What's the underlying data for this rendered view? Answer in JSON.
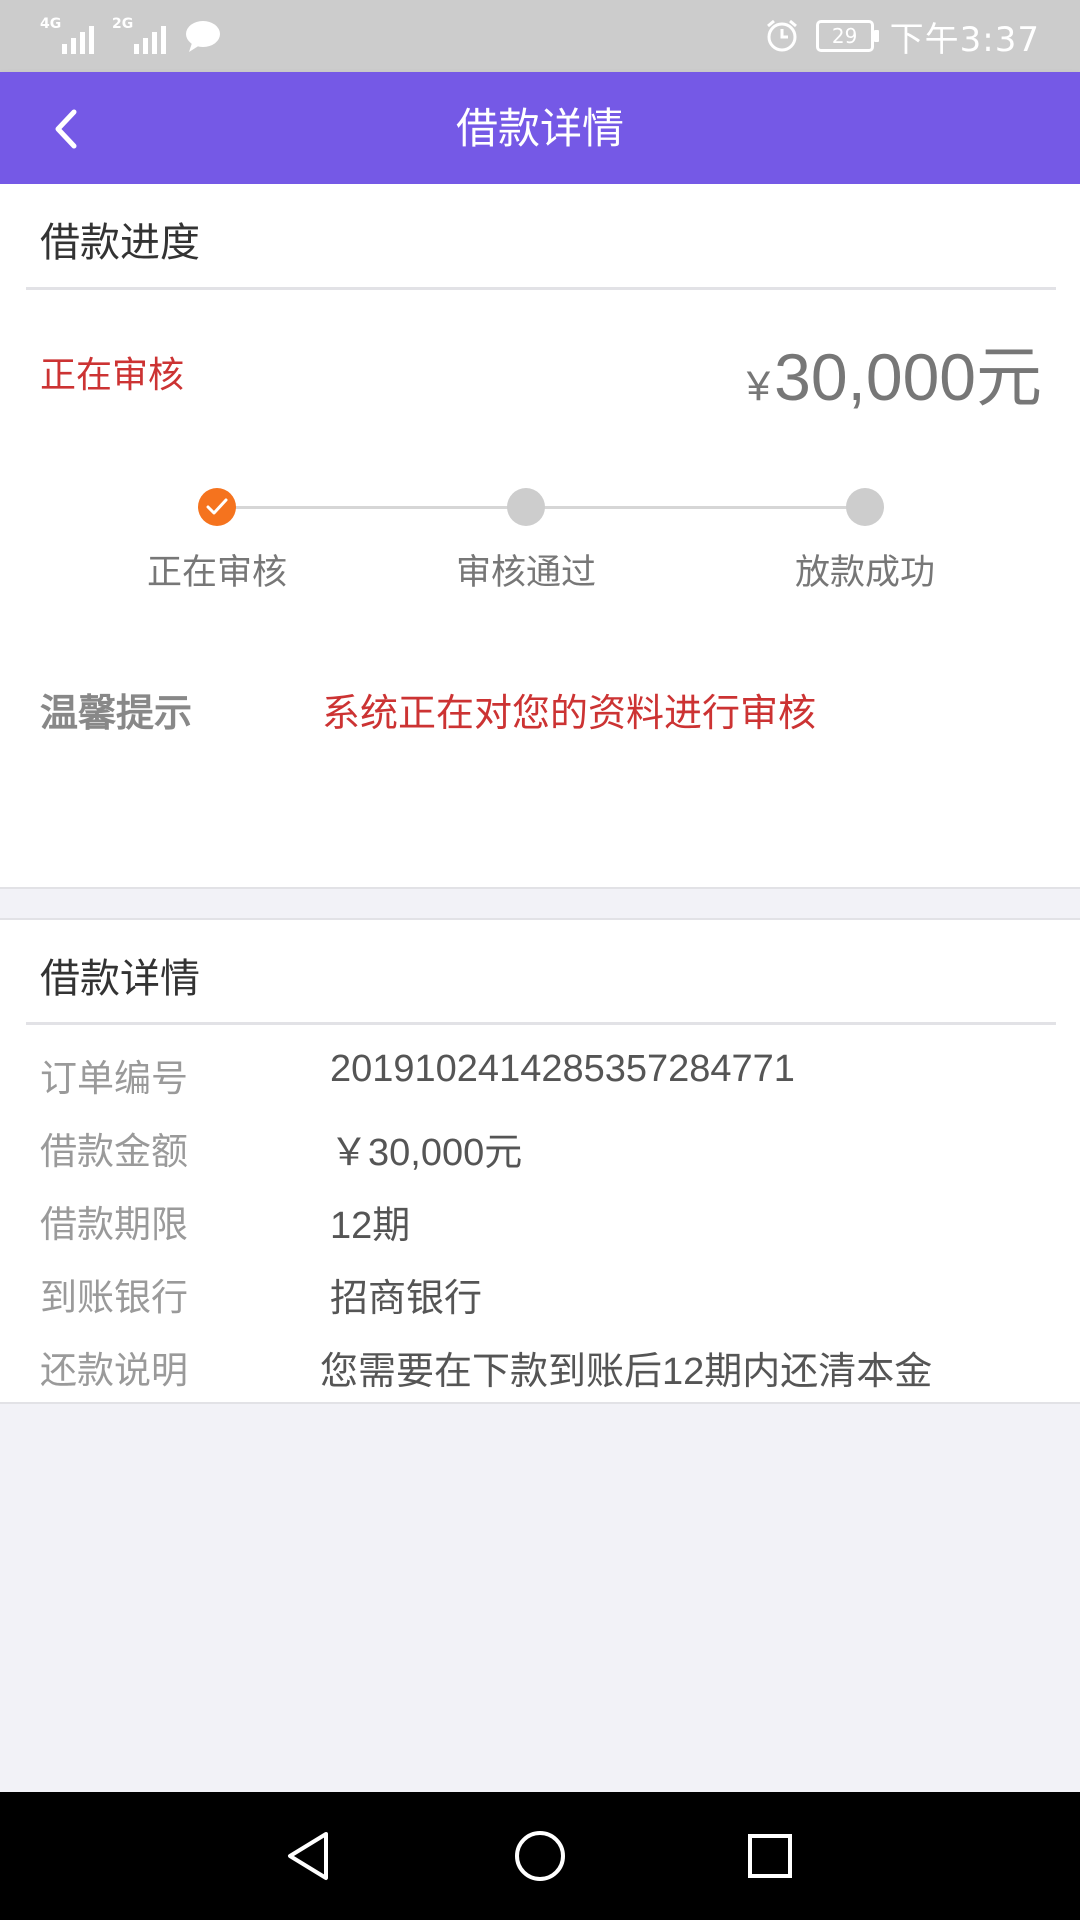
{
  "status_bar": {
    "network_1": "4G",
    "network_2": "2G",
    "battery": "29",
    "time": "下午3:37",
    "icons": [
      "signal-icon",
      "signal-icon",
      "message-icon",
      "alarm-icon",
      "battery-icon"
    ]
  },
  "header": {
    "title": "借款详情",
    "back_icon": "chevron-left-icon",
    "background_color": "#7559e6"
  },
  "progress_section": {
    "title": "借款进度",
    "status": "正在审核",
    "amount_symbol": "¥",
    "amount": "30,000元",
    "steps": [
      {
        "label": "正在审核",
        "state": "active"
      },
      {
        "label": "审核通过",
        "state": "pending"
      },
      {
        "label": "放款成功",
        "state": "pending"
      }
    ],
    "tip_label": "温馨提示",
    "tip_text": "系统正在对您的资料进行审核"
  },
  "details_section": {
    "title": "借款详情",
    "rows": [
      {
        "label": "订单编号",
        "value": "201910241428535728477 1"
      },
      {
        "label": "借款金额",
        "value": "￥30,000元"
      },
      {
        "label": "借款期限",
        "value": "12期"
      },
      {
        "label": "到账银行",
        "value": "招商银行"
      },
      {
        "label": "还款说明",
        "value": "您需要在下款到账后12期内还清本金"
      }
    ]
  },
  "colors": {
    "accent": "#7559e6",
    "status_red": "#cc3333",
    "step_active": "#f5731e",
    "step_pending": "#cdcdcd"
  },
  "nav_bar": {
    "icons": [
      "back-triangle-icon",
      "home-circle-icon",
      "recents-square-icon"
    ]
  }
}
